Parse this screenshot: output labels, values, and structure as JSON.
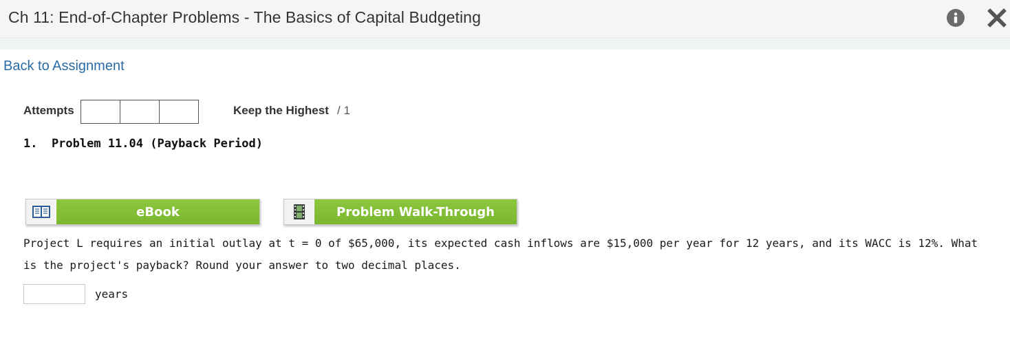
{
  "header": {
    "title": "Ch 11: End-of-Chapter Problems - The Basics of Capital Budgeting",
    "info_icon": "info-icon",
    "close_icon": "close-icon"
  },
  "nav": {
    "back_link": "Back to Assignment"
  },
  "attempts": {
    "label": "Attempts",
    "boxes": [
      "",
      "",
      ""
    ],
    "keep_label": "Keep the Highest",
    "keep_value": "/ 1"
  },
  "problem": {
    "title": "1.  Problem 11.04 (Payback Period)",
    "question": "Project L requires an initial outlay at t = 0 of $65,000, its expected cash inflows are $15,000 per year for 12 years, and its WACC is 12%. What is the project's payback? Round your answer to two decimal places.",
    "answer_value": "",
    "answer_unit": "years"
  },
  "resources": {
    "ebook": {
      "label": "eBook",
      "icon": "book-icon"
    },
    "walkthrough": {
      "label": "Problem Walk-Through",
      "icon": "film-icon"
    }
  },
  "colors": {
    "accent_green": "#8dc63f",
    "link_blue": "#2a6aa5",
    "header_bg": "#f5f5f5"
  }
}
